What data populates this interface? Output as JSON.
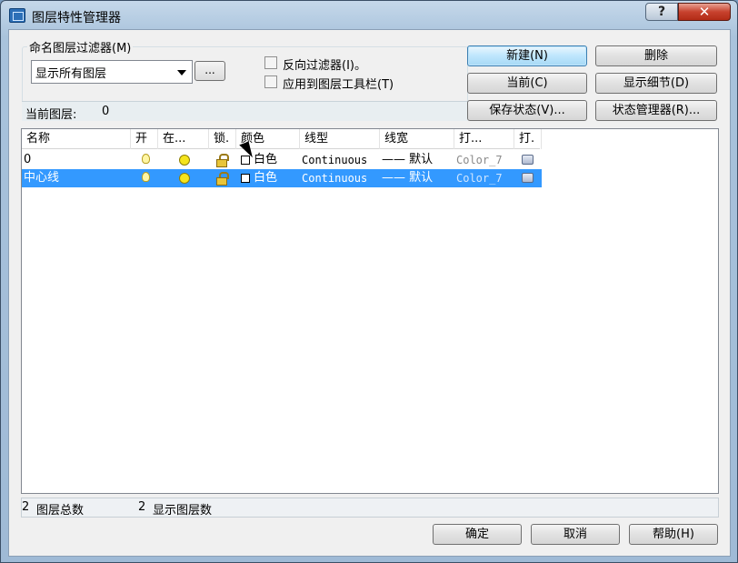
{
  "window": {
    "title": "图层特性管理器",
    "help_glyph": "?",
    "close_glyph": "✕"
  },
  "filter": {
    "group_label": "命名图层过滤器(M)",
    "selected": "显示所有图层",
    "dots_label": "...",
    "invert_label": "反向过滤器(I)。",
    "apply_toolbar_label": "应用到图层工具栏(T)"
  },
  "current_layer": {
    "label": "当前图层:",
    "value": "0"
  },
  "buttons": {
    "new": "新建(N)",
    "delete": "删除",
    "current": "当前(C)",
    "show_details": "显示细节(D)",
    "save_state": "保存状态(V)...",
    "state_manager": "状态管理器(R)..."
  },
  "columns": [
    "名称",
    "开",
    "在...",
    "锁.",
    "颜色",
    "线型",
    "线宽",
    "打...",
    "打."
  ],
  "rows": [
    {
      "name": "0",
      "color": "白色",
      "linetype": "Continuous",
      "lineweight": "—— 默认",
      "plotstyle": "Color_7",
      "selected": false
    },
    {
      "name": "中心线",
      "color": "白色",
      "linetype": "Continuous",
      "lineweight": "—— 默认",
      "plotstyle": "Color_7",
      "selected": true
    }
  ],
  "status": {
    "total_count": "2",
    "total_label": "图层总数",
    "shown_count": "2",
    "shown_label": "显示图层数"
  },
  "footer": {
    "ok": "确定",
    "cancel": "取消",
    "help": "帮助(H)"
  }
}
